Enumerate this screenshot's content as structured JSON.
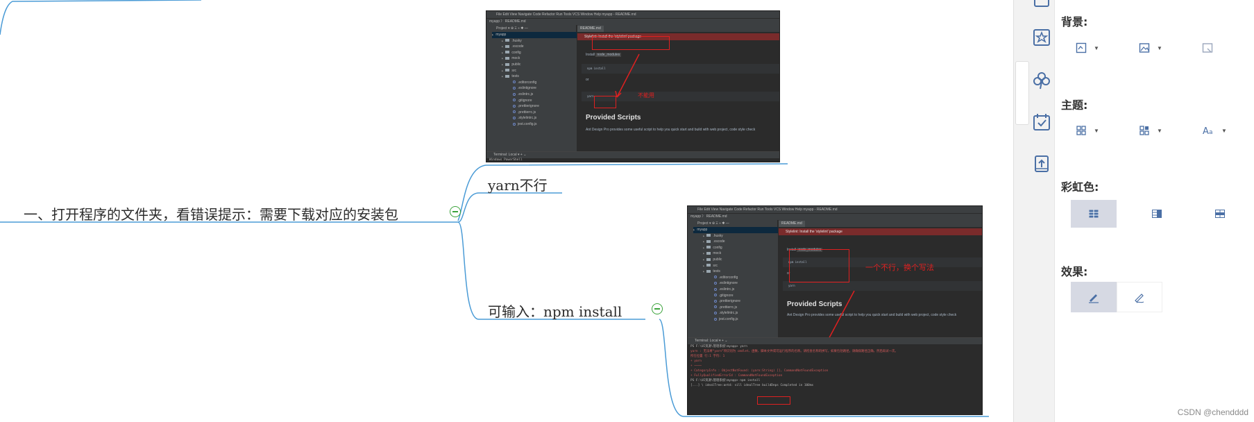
{
  "mindmap": {
    "root": {
      "label": "一、打开程序的文件夹，看错误提示：需要下载对应的安装包"
    },
    "branches": [
      {
        "label": "yarn不行"
      },
      {
        "label": "可输入：npm install"
      }
    ]
  },
  "screenshot1": {
    "menu": "File  Edit  View  Navigate  Code  Refactor  Run  Tools  VCS  Window  Help     myapp - README.md",
    "breadcrumb": "myapp  〉 README.md",
    "toolbar": "Project ▾          ⊕  Ξ  ÷  ✱  —",
    "tab": "README.md",
    "root_folder": "myapp",
    "tree": [
      ".husky",
      ".vscode",
      "config",
      "mock",
      "public",
      "src",
      "tests",
      ".editorconfig",
      ".eslintignore",
      ".eslintrc.js",
      ".gitignore",
      ".prettierignore",
      ".prettierrc.js",
      ".stylelintrc.js",
      "jest.config.js"
    ],
    "warning": "Stylelint: Install the 'stylelint' package",
    "install_label": "Install",
    "install_chip": "node_modules",
    "code_npm": "npm install",
    "or": "or",
    "code_yarn": "yarn",
    "annotation": "不能用",
    "heading": "Provided Scripts",
    "description": "Ant Design Pro provides some useful script to help you quick start and build with web project, code style check",
    "terminal_tabs": "Terminal:   Local ▾   +   ⌄",
    "terminal_line": "Windows PowerShell"
  },
  "screenshot2": {
    "menu": "File  Edit  View  Navigate  Code  Refactor  Run  Tools  VCS  Window  Help     myapp - README.md",
    "breadcrumb": "myapp  〉 README.md",
    "toolbar": "Project ▾          ⊕  Ξ  ÷  ✱  —",
    "tab": "README.md",
    "root_folder": "myapp",
    "tree": [
      ".husky",
      ".vscode",
      "config",
      "mock",
      "public",
      "src",
      "tests",
      ".editorconfig",
      ".eslintignore",
      ".eslintrc.js",
      ".gitignore",
      ".prettierignore",
      ".prettierrc.js",
      ".stylelintrc.js",
      "jest.config.js"
    ],
    "warning": "Stylelint: Install the 'stylelint' package",
    "install_label": "Install",
    "install_chip": "node_modules",
    "code_npm": "npm install",
    "or": "or",
    "code_yarn": "yarn",
    "annotation": "一个不行，换个写法",
    "heading": "Provided Scripts",
    "description": "Ant Design Pro provides some useful script to help you quick start and build with web project, code style check",
    "terminal_tabs": "Terminal:   Local ▾   +   ⌄",
    "terminal_lines": [
      "PS F:\\UI资源\\管理系统\\myapp> yarn",
      "yarn : 无法将“yarn”项识别为 cmdlet、函数、脚本文件或可运行程序的名称。请检查名称的拼写，如果包括路径，请确保路径正确，然后再试一次。",
      "所在位置 行:1 字符: 1",
      "+ yarn",
      "+ ~~~~",
      "    + CategoryInfo          : ObjectNotFound: (yarn:String) [], CommandNotFoundException",
      "    + FullyQualifiedErrorId : CommandNotFoundException",
      "",
      "PS F:\\UI资源\\管理系统\\myapp> npm install",
      "[...] \\ idealTree:antd: sill idealTree buildDeps  Completed in 100ms"
    ]
  },
  "panel": {
    "sections": {
      "background": "背景:",
      "theme": "主题:",
      "rainbow": "彩虹色:",
      "effect": "效果:"
    }
  },
  "watermark": "CSDN @chendddd",
  "colors": {
    "branch_line": "#4a9bd6",
    "collapse": "#3aa33a",
    "annotation_red": "#e02020",
    "active_tool": "#d6d9e3",
    "icon_blue": "#4a6fa5"
  }
}
